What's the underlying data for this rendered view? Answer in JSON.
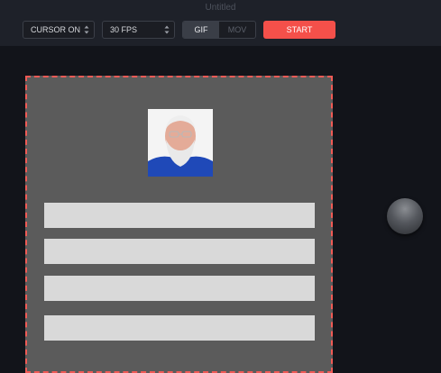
{
  "window": {
    "title": "Untitled"
  },
  "toolbar": {
    "cursor_select": {
      "value": "CURSOR ON"
    },
    "fps_select": {
      "value": "30 FPS"
    },
    "format": {
      "options": [
        "GIF",
        "MOV"
      ],
      "selected": "GIF"
    },
    "start_label": "START"
  },
  "colors": {
    "toolbar_bg": "#1e2129",
    "page_bg": "#12141a",
    "accent": "#f4504a",
    "capture_bg": "#5b5b5b",
    "field_bg": "#d9d9d9"
  },
  "capture_area": {
    "avatar_icon": "profile-photo",
    "fields": [
      {},
      {},
      {},
      {}
    ]
  },
  "record_knob": {
    "icon": "round-knob"
  }
}
